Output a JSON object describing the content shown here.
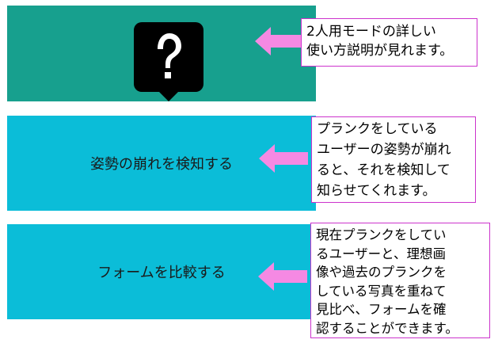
{
  "colors": {
    "help_panel": "#17a08e",
    "feature_panel": "#0bbdd8",
    "arrow": "#f589e3",
    "callout_border": "#cc33cc"
  },
  "help": {
    "icon": "help-speech-bubble-icon",
    "callout": "2人用モードの詳しい\n使い方説明が見れます。"
  },
  "detect": {
    "label": "姿勢の崩れを検知する",
    "callout": "プランクをしている\nユーザーの姿勢が崩れ\nると、それを検知して\n知らせてくれます。"
  },
  "compare": {
    "label": "フォームを比較する",
    "callout": "現在プランクをしてい\nるユーザーと、理想画\n像や過去のプランクを\nしている写真を重ねて\n見比べ、フォームを確\n認することができます。"
  }
}
